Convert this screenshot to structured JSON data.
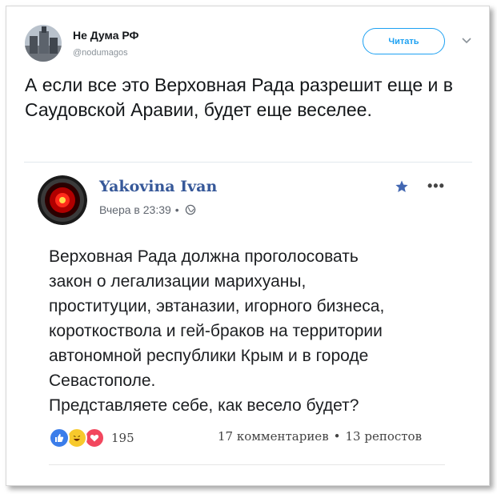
{
  "tweet": {
    "display_name": "Не Дума РФ",
    "handle": "@nodumagos",
    "follow_label": "Читать",
    "text": "А если все это Верховная Рада разрешит еще и в Саудовской Аравии, будет еще веселее."
  },
  "embedded_post": {
    "author": "Yakovina Ivan",
    "time": "Вчера в 23:39",
    "meta_dot": "•",
    "text_lines": [
      "Верховная Рада должна проголосовать",
      "закон о легализации марихуаны,",
      "проституции, эвтаназии, игорного бизнеса,",
      "короткоствола и гей-браков на территории",
      "автономной республики Крым и в городе",
      "Севастополе.",
      "Представляете себе, как весело будет?"
    ],
    "reaction_count": "195",
    "comments": "17 комментариев",
    "stats_sep": "•",
    "shares": "13 репостов",
    "more_label": "•••"
  },
  "colors": {
    "twitter_blue": "#1da1f2",
    "fb_name": "#365899",
    "like": "#3b7dea",
    "haha": "#f7c92c",
    "love": "#f2475e"
  },
  "icons": [
    "caret-down-icon",
    "star-icon",
    "globe-icon",
    "like-reaction-icon",
    "haha-reaction-icon",
    "love-reaction-icon",
    "more-icon"
  ]
}
